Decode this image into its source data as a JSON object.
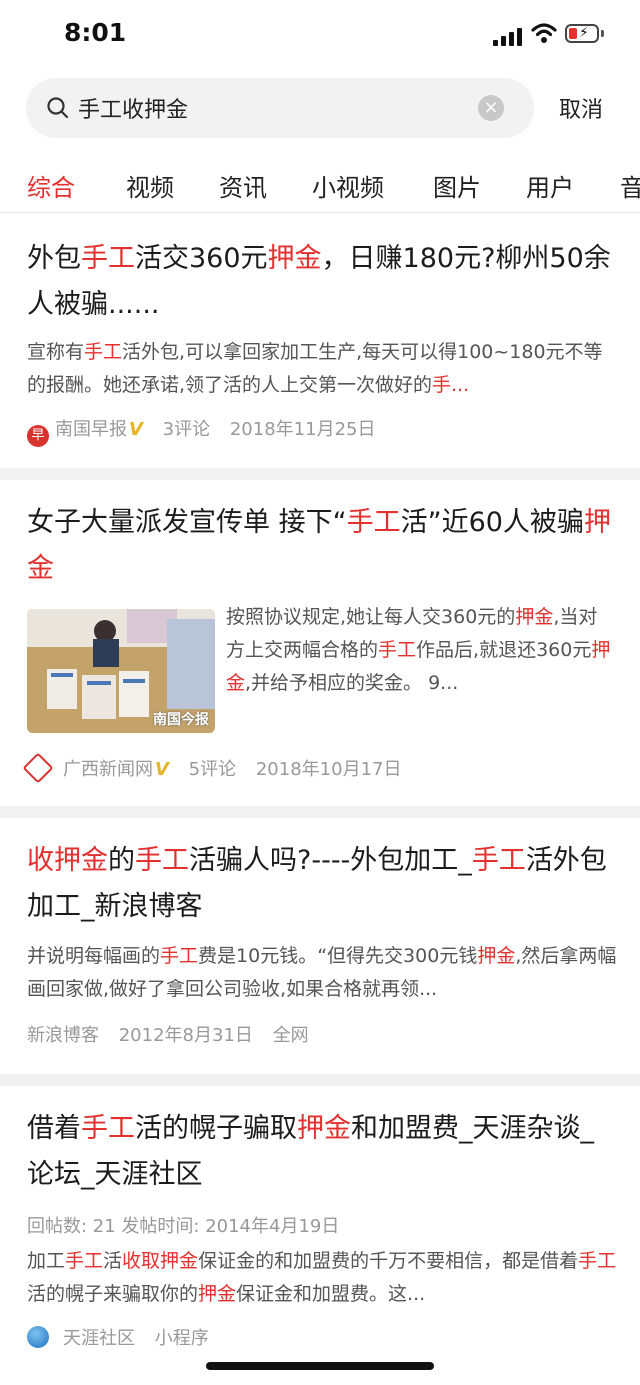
{
  "status": {
    "time": "8:01"
  },
  "search": {
    "query": "手工收押金",
    "cancel": "取消"
  },
  "tabs": [
    "综合",
    "视频",
    "资讯",
    "小视频",
    "图片",
    "用户",
    "音"
  ],
  "results": [
    {
      "title": [
        [
          "外包",
          0
        ],
        [
          "手工",
          1
        ],
        [
          "活交360元",
          0
        ],
        [
          "押金",
          1
        ],
        [
          "，日赚180元?柳州50余人被骗......",
          0
        ]
      ],
      "snippet": [
        [
          "宣称有",
          0
        ],
        [
          "手工",
          1
        ],
        [
          "活外包,可以拿回家加工生产,每天可以得100~180元不等的报酬。她还承诺,领了活的人上交第一次做好的",
          0
        ],
        [
          "手...",
          1
        ]
      ],
      "source": "南国早报",
      "verified": "V",
      "comments": "3评论",
      "date": "2018年11月25日"
    },
    {
      "title": [
        [
          "女子大量派发宣传单 接下“",
          0
        ],
        [
          "手工",
          1
        ],
        [
          "活”近60人被骗",
          0
        ],
        [
          "押金",
          1
        ]
      ],
      "snippet": [
        [
          "按照协议规定,她让每人交360元的",
          0
        ],
        [
          "押金",
          1
        ],
        [
          ",当对方上交两幅合格的",
          0
        ],
        [
          "手工",
          1
        ],
        [
          "作品后,就退还360元",
          0
        ],
        [
          "押金",
          1
        ],
        [
          ",并给予相应的奖金。 9...",
          0
        ]
      ],
      "image_watermark": "南国今报",
      "source": "广西新闻网",
      "verified": "V",
      "comments": "5评论",
      "date": "2018年10月17日"
    },
    {
      "title": [
        [
          "收押金",
          1
        ],
        [
          "的",
          0
        ],
        [
          "手工",
          1
        ],
        [
          "活骗人吗?----外包加工_",
          0
        ],
        [
          "手工",
          1
        ],
        [
          "活外包加工_新浪博客",
          0
        ]
      ],
      "snippet": [
        [
          "并说明每幅画的",
          0
        ],
        [
          "手工",
          1
        ],
        [
          "费是10元钱。“但得先交300元钱",
          0
        ],
        [
          "押金",
          1
        ],
        [
          ",然后拿两幅画回家做,做好了拿回公司验收,如果合格就再领...",
          0
        ]
      ],
      "source": "新浪博客",
      "date": "2012年8月31日",
      "scope": "全网"
    },
    {
      "title": [
        [
          "借着",
          0
        ],
        [
          "手工",
          1
        ],
        [
          "活的幌子骗取",
          0
        ],
        [
          "押金",
          1
        ],
        [
          "和加盟费_天涯杂谈_论坛_天涯社区",
          0
        ]
      ],
      "extra": "回帖数: 21   发帖时间: 2014年4月19日",
      "snippet": [
        [
          "加工",
          0
        ],
        [
          "手工",
          1
        ],
        [
          "活",
          0
        ],
        [
          "收取押金",
          1
        ],
        [
          "保证金的和加盟费的千万不要相信，都是借着",
          0
        ],
        [
          "手工",
          1
        ],
        [
          "活的幌子来骗取你的",
          0
        ],
        [
          "押金",
          1
        ],
        [
          "保证金和加盟费。这...",
          0
        ]
      ],
      "source": "天涯社区",
      "type_label": "小程序"
    }
  ],
  "colors": {
    "highlight": "#e2312f",
    "verified": "#e6b422",
    "separator": "#f2f2f2"
  }
}
